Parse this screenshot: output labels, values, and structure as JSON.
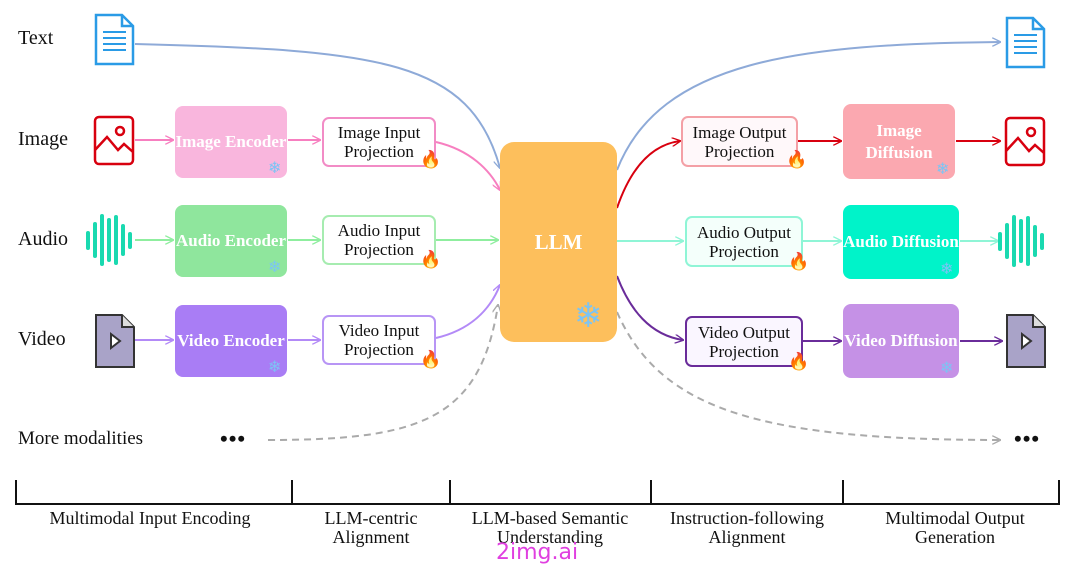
{
  "rows": {
    "text": "Text",
    "image": "Image",
    "audio": "Audio",
    "video": "Video",
    "more": "More modalities",
    "ellipsis": "•••"
  },
  "encoders": {
    "image": "Image Encoder",
    "audio": "Audio Encoder",
    "video": "Video Encoder"
  },
  "input_projections": {
    "image": "Image Input Projection",
    "audio": "Audio Input Projection",
    "video": "Video Input Projection"
  },
  "llm": "LLM",
  "output_projections": {
    "image": "Image Output Projection",
    "audio": "Audio Output Projection",
    "video": "Video Output Projection"
  },
  "diffusions": {
    "image": "Image Diffusion",
    "audio": "Audio Diffusion",
    "video": "Video Diffusion"
  },
  "stages": [
    "Multimodal Input Encoding",
    "LLM-centric Alignment",
    "LLM-based Semantic Understanding",
    "Instruction-following Alignment",
    "Multimodal Output Generation"
  ],
  "icons": {
    "frozen": "snowflake-icon",
    "trainable": "fire-icon"
  },
  "watermark": "2img.ai",
  "colors": {
    "image_encoder": "#f9b6dd",
    "audio_encoder": "#8fe69d",
    "video_encoder": "#a97df5",
    "llm": "#fdbf5c",
    "image_diffusion": "#fba8b0",
    "audio_diffusion": "#00f3c9",
    "video_diffusion": "#c591e6",
    "text_arrow": "#8eaad8",
    "image_out_arrow": "#d8000f",
    "video_out_arrow": "#6a2c9a"
  }
}
